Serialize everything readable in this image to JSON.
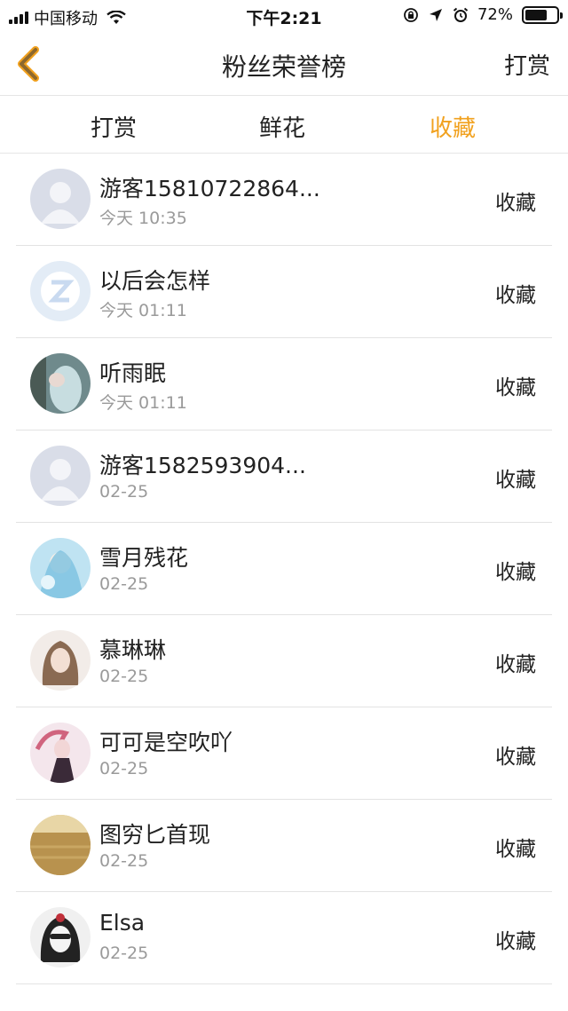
{
  "status_bar": {
    "carrier": "中国移动",
    "time": "下午2:21",
    "battery": "72%",
    "battery_level": 0.72
  },
  "nav": {
    "title": "粉丝荣誉榜",
    "right_action": "打赏",
    "back_icon": "chevron-left-icon",
    "accent_color": "#f1a11e"
  },
  "tabs": [
    {
      "label": "打赏",
      "active": false
    },
    {
      "label": "鲜花",
      "active": false
    },
    {
      "label": "收藏",
      "active": true
    }
  ],
  "list": [
    {
      "name": "游客15810722864...",
      "time": "今天 10:35",
      "action": "收藏",
      "avatar": "default-avatar"
    },
    {
      "name": "以后会怎样",
      "time": "今天 01:11",
      "action": "收藏",
      "avatar": "qq-logo"
    },
    {
      "name": "听雨眠",
      "time": "今天 01:11",
      "action": "收藏",
      "avatar": "photo"
    },
    {
      "name": "游客1582593904...",
      "time": "02-25",
      "action": "收藏",
      "avatar": "default-avatar"
    },
    {
      "name": "雪月残花",
      "time": "02-25",
      "action": "收藏",
      "avatar": "anime-blue"
    },
    {
      "name": "慕琳琳",
      "time": "02-25",
      "action": "收藏",
      "avatar": "anime-girl"
    },
    {
      "name": "可可是空吹吖",
      "time": "02-25",
      "action": "收藏",
      "avatar": "anime-pink"
    },
    {
      "name": "图穷匕首现",
      "time": "02-25",
      "action": "收藏",
      "avatar": "wheat-field"
    },
    {
      "name": "Elsa",
      "time": "02-25",
      "action": "收藏",
      "avatar": "sketch-girl"
    }
  ]
}
